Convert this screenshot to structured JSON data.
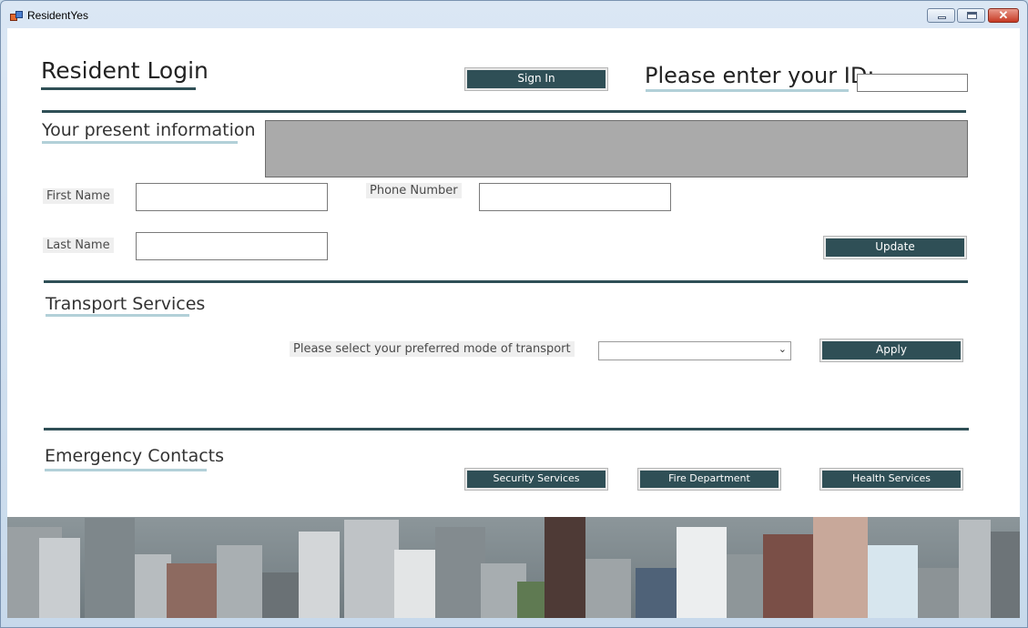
{
  "window": {
    "title": "ResidentYes"
  },
  "login": {
    "heading": "Resident Login",
    "sign_in_label": "Sign In",
    "id_prompt": "Please enter your ID:",
    "id_value": ""
  },
  "present_info": {
    "heading": "Your present information",
    "first_name_label": "First Name",
    "first_name_value": "",
    "last_name_label": "Last Name",
    "last_name_value": "",
    "phone_label": "Phone Number",
    "phone_value": "",
    "update_label": "Update"
  },
  "transport": {
    "heading": "Transport Services",
    "prompt": "Please select your preferred mode of transport",
    "selected": "",
    "apply_label": "Apply"
  },
  "emergency": {
    "heading": "Emergency Contacts",
    "buttons": [
      "Security Services",
      "Fire Department",
      "Health Services"
    ]
  },
  "colors": {
    "accent_dark": "#2f4f56",
    "accent_light": "#b2d0d8",
    "button_text": "#ffffff"
  }
}
